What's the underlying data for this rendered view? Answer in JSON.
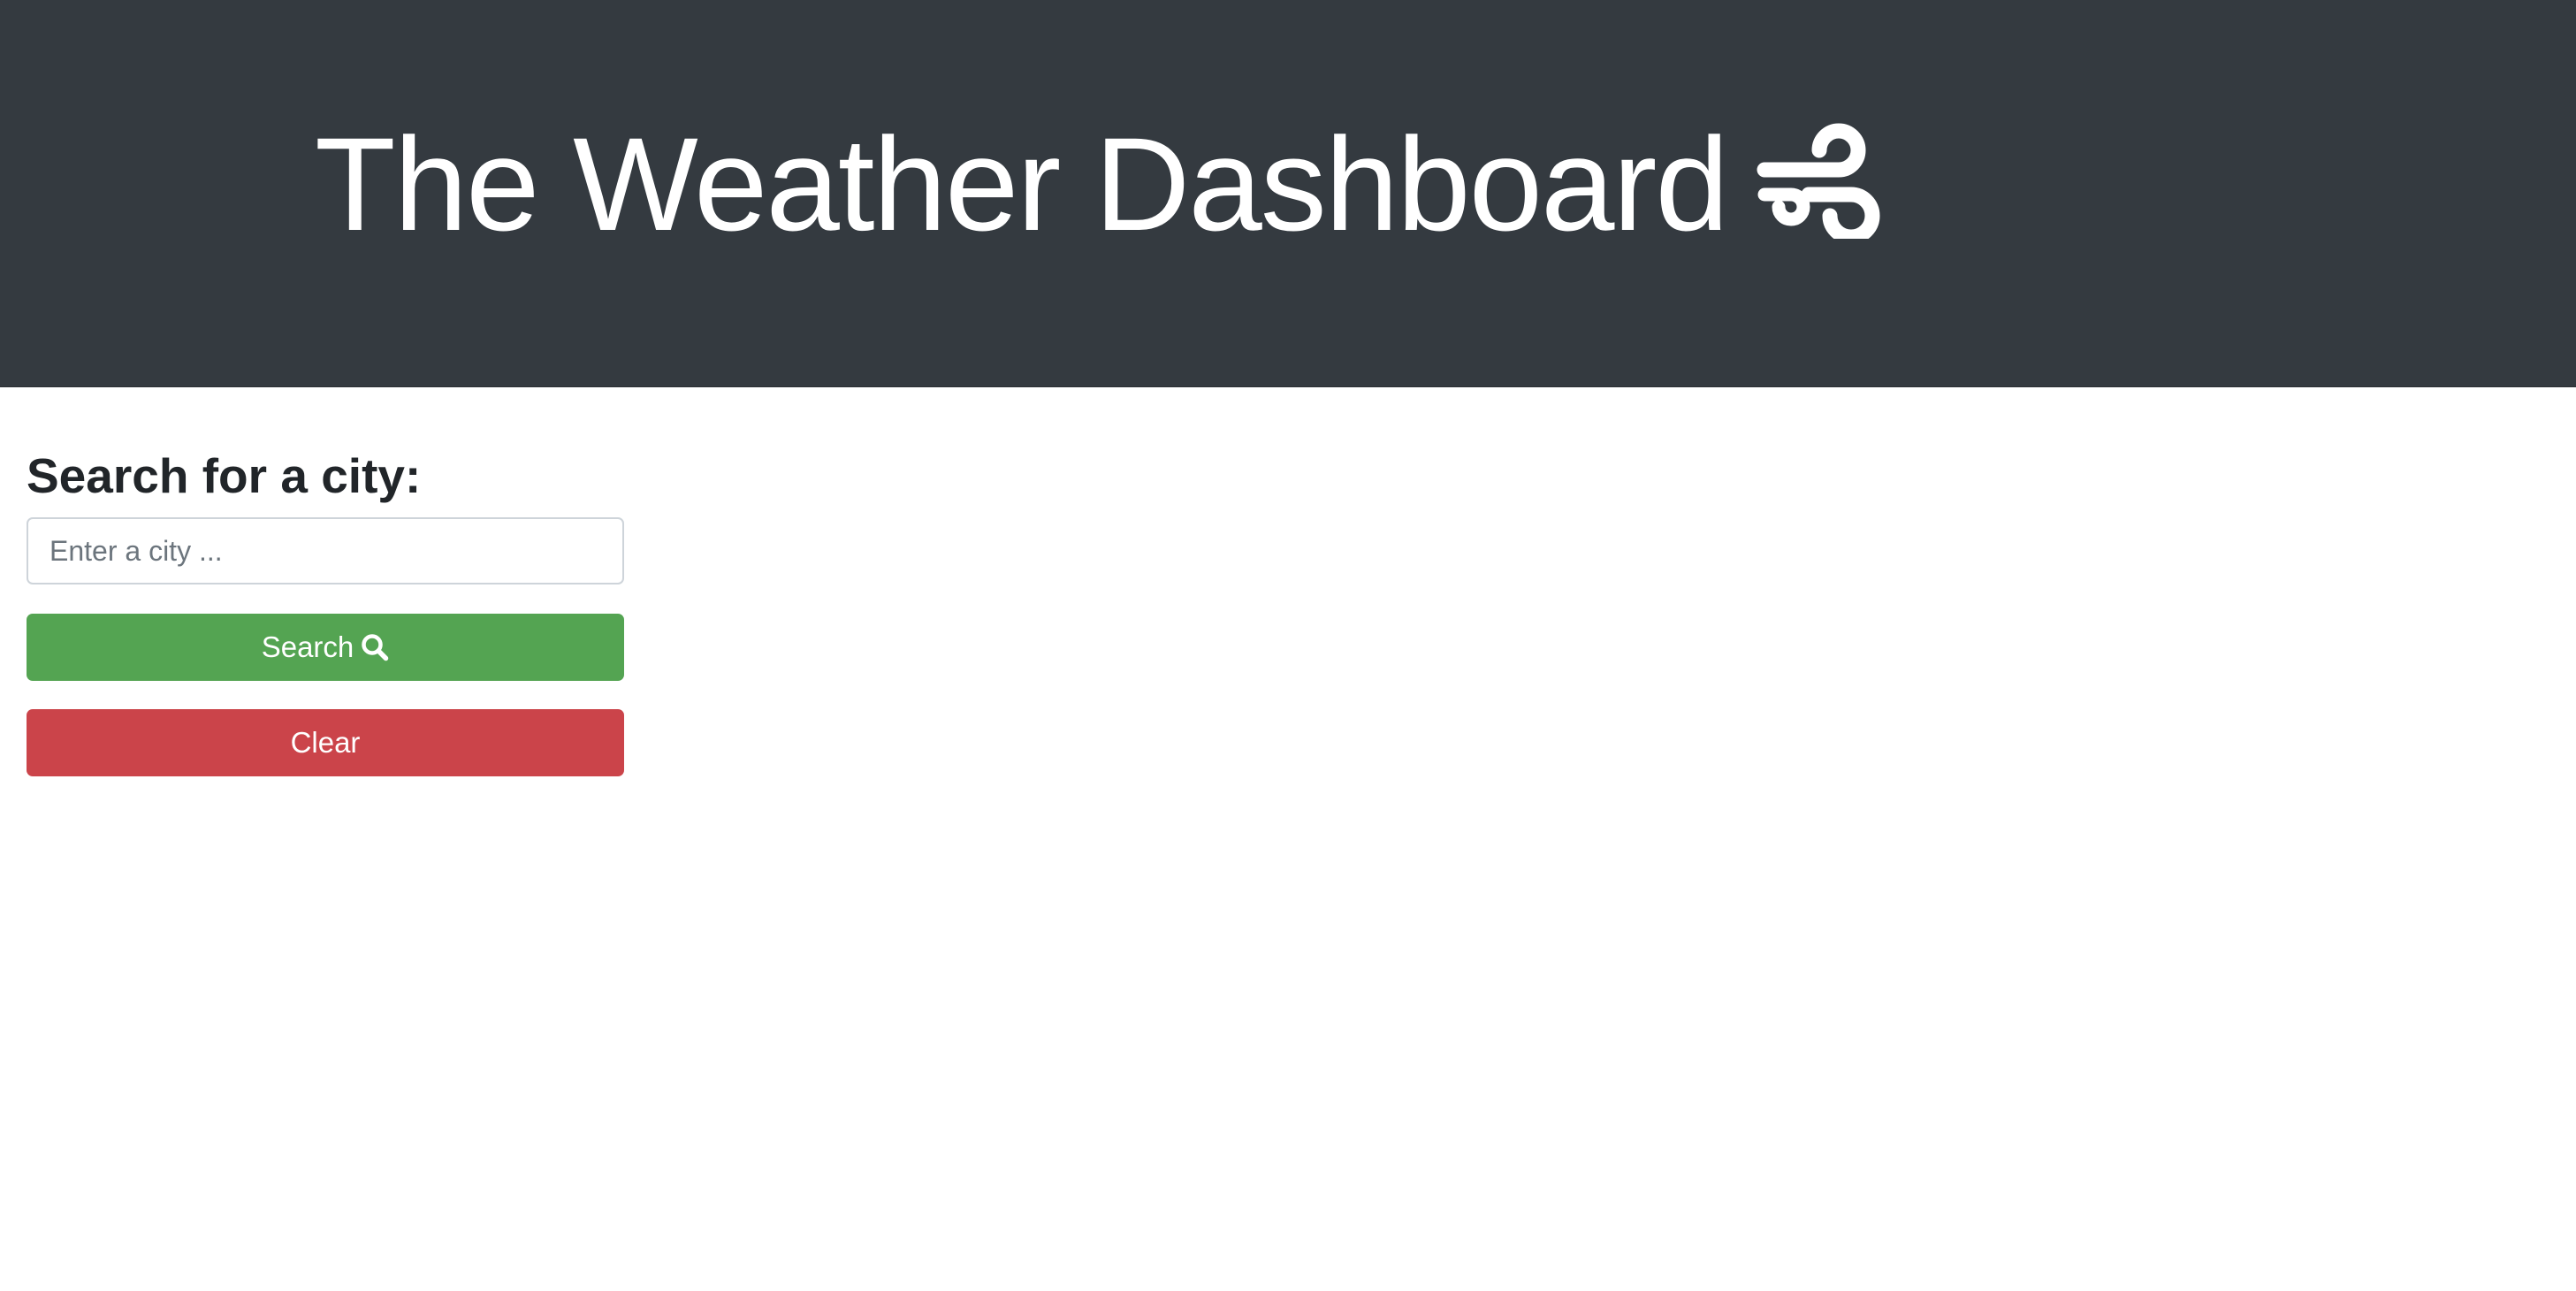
{
  "header": {
    "title": "The Weather Dashboard",
    "icon": "wind-icon",
    "background_color": "#343a40"
  },
  "search": {
    "heading": "Search for a city:",
    "input_placeholder": "Enter a city ...",
    "input_value": "",
    "search_button_label": "Search",
    "search_button_icon": "search-icon",
    "search_button_color": "#54a452",
    "clear_button_label": "Clear",
    "clear_button_color": "#cb444a"
  }
}
